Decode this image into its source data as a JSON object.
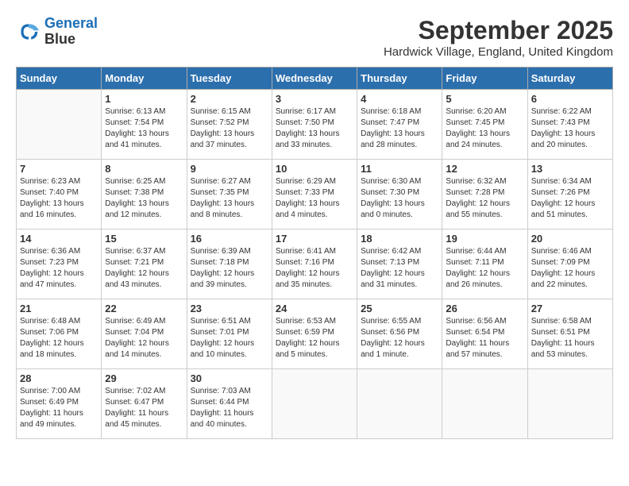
{
  "logo": {
    "line1": "General",
    "line2": "Blue"
  },
  "title": "September 2025",
  "location": "Hardwick Village, England, United Kingdom",
  "headers": [
    "Sunday",
    "Monday",
    "Tuesday",
    "Wednesday",
    "Thursday",
    "Friday",
    "Saturday"
  ],
  "weeks": [
    [
      {
        "day": "",
        "sunrise": "",
        "sunset": "",
        "daylight": ""
      },
      {
        "day": "1",
        "sunrise": "Sunrise: 6:13 AM",
        "sunset": "Sunset: 7:54 PM",
        "daylight": "Daylight: 13 hours and 41 minutes."
      },
      {
        "day": "2",
        "sunrise": "Sunrise: 6:15 AM",
        "sunset": "Sunset: 7:52 PM",
        "daylight": "Daylight: 13 hours and 37 minutes."
      },
      {
        "day": "3",
        "sunrise": "Sunrise: 6:17 AM",
        "sunset": "Sunset: 7:50 PM",
        "daylight": "Daylight: 13 hours and 33 minutes."
      },
      {
        "day": "4",
        "sunrise": "Sunrise: 6:18 AM",
        "sunset": "Sunset: 7:47 PM",
        "daylight": "Daylight: 13 hours and 28 minutes."
      },
      {
        "day": "5",
        "sunrise": "Sunrise: 6:20 AM",
        "sunset": "Sunset: 7:45 PM",
        "daylight": "Daylight: 13 hours and 24 minutes."
      },
      {
        "day": "6",
        "sunrise": "Sunrise: 6:22 AM",
        "sunset": "Sunset: 7:43 PM",
        "daylight": "Daylight: 13 hours and 20 minutes."
      }
    ],
    [
      {
        "day": "7",
        "sunrise": "Sunrise: 6:23 AM",
        "sunset": "Sunset: 7:40 PM",
        "daylight": "Daylight: 13 hours and 16 minutes."
      },
      {
        "day": "8",
        "sunrise": "Sunrise: 6:25 AM",
        "sunset": "Sunset: 7:38 PM",
        "daylight": "Daylight: 13 hours and 12 minutes."
      },
      {
        "day": "9",
        "sunrise": "Sunrise: 6:27 AM",
        "sunset": "Sunset: 7:35 PM",
        "daylight": "Daylight: 13 hours and 8 minutes."
      },
      {
        "day": "10",
        "sunrise": "Sunrise: 6:29 AM",
        "sunset": "Sunset: 7:33 PM",
        "daylight": "Daylight: 13 hours and 4 minutes."
      },
      {
        "day": "11",
        "sunrise": "Sunrise: 6:30 AM",
        "sunset": "Sunset: 7:30 PM",
        "daylight": "Daylight: 13 hours and 0 minutes."
      },
      {
        "day": "12",
        "sunrise": "Sunrise: 6:32 AM",
        "sunset": "Sunset: 7:28 PM",
        "daylight": "Daylight: 12 hours and 55 minutes."
      },
      {
        "day": "13",
        "sunrise": "Sunrise: 6:34 AM",
        "sunset": "Sunset: 7:26 PM",
        "daylight": "Daylight: 12 hours and 51 minutes."
      }
    ],
    [
      {
        "day": "14",
        "sunrise": "Sunrise: 6:36 AM",
        "sunset": "Sunset: 7:23 PM",
        "daylight": "Daylight: 12 hours and 47 minutes."
      },
      {
        "day": "15",
        "sunrise": "Sunrise: 6:37 AM",
        "sunset": "Sunset: 7:21 PM",
        "daylight": "Daylight: 12 hours and 43 minutes."
      },
      {
        "day": "16",
        "sunrise": "Sunrise: 6:39 AM",
        "sunset": "Sunset: 7:18 PM",
        "daylight": "Daylight: 12 hours and 39 minutes."
      },
      {
        "day": "17",
        "sunrise": "Sunrise: 6:41 AM",
        "sunset": "Sunset: 7:16 PM",
        "daylight": "Daylight: 12 hours and 35 minutes."
      },
      {
        "day": "18",
        "sunrise": "Sunrise: 6:42 AM",
        "sunset": "Sunset: 7:13 PM",
        "daylight": "Daylight: 12 hours and 31 minutes."
      },
      {
        "day": "19",
        "sunrise": "Sunrise: 6:44 AM",
        "sunset": "Sunset: 7:11 PM",
        "daylight": "Daylight: 12 hours and 26 minutes."
      },
      {
        "day": "20",
        "sunrise": "Sunrise: 6:46 AM",
        "sunset": "Sunset: 7:09 PM",
        "daylight": "Daylight: 12 hours and 22 minutes."
      }
    ],
    [
      {
        "day": "21",
        "sunrise": "Sunrise: 6:48 AM",
        "sunset": "Sunset: 7:06 PM",
        "daylight": "Daylight: 12 hours and 18 minutes."
      },
      {
        "day": "22",
        "sunrise": "Sunrise: 6:49 AM",
        "sunset": "Sunset: 7:04 PM",
        "daylight": "Daylight: 12 hours and 14 minutes."
      },
      {
        "day": "23",
        "sunrise": "Sunrise: 6:51 AM",
        "sunset": "Sunset: 7:01 PM",
        "daylight": "Daylight: 12 hours and 10 minutes."
      },
      {
        "day": "24",
        "sunrise": "Sunrise: 6:53 AM",
        "sunset": "Sunset: 6:59 PM",
        "daylight": "Daylight: 12 hours and 5 minutes."
      },
      {
        "day": "25",
        "sunrise": "Sunrise: 6:55 AM",
        "sunset": "Sunset: 6:56 PM",
        "daylight": "Daylight: 12 hours and 1 minute."
      },
      {
        "day": "26",
        "sunrise": "Sunrise: 6:56 AM",
        "sunset": "Sunset: 6:54 PM",
        "daylight": "Daylight: 11 hours and 57 minutes."
      },
      {
        "day": "27",
        "sunrise": "Sunrise: 6:58 AM",
        "sunset": "Sunset: 6:51 PM",
        "daylight": "Daylight: 11 hours and 53 minutes."
      }
    ],
    [
      {
        "day": "28",
        "sunrise": "Sunrise: 7:00 AM",
        "sunset": "Sunset: 6:49 PM",
        "daylight": "Daylight: 11 hours and 49 minutes."
      },
      {
        "day": "29",
        "sunrise": "Sunrise: 7:02 AM",
        "sunset": "Sunset: 6:47 PM",
        "daylight": "Daylight: 11 hours and 45 minutes."
      },
      {
        "day": "30",
        "sunrise": "Sunrise: 7:03 AM",
        "sunset": "Sunset: 6:44 PM",
        "daylight": "Daylight: 11 hours and 40 minutes."
      },
      {
        "day": "",
        "sunrise": "",
        "sunset": "",
        "daylight": ""
      },
      {
        "day": "",
        "sunrise": "",
        "sunset": "",
        "daylight": ""
      },
      {
        "day": "",
        "sunrise": "",
        "sunset": "",
        "daylight": ""
      },
      {
        "day": "",
        "sunrise": "",
        "sunset": "",
        "daylight": ""
      }
    ]
  ]
}
